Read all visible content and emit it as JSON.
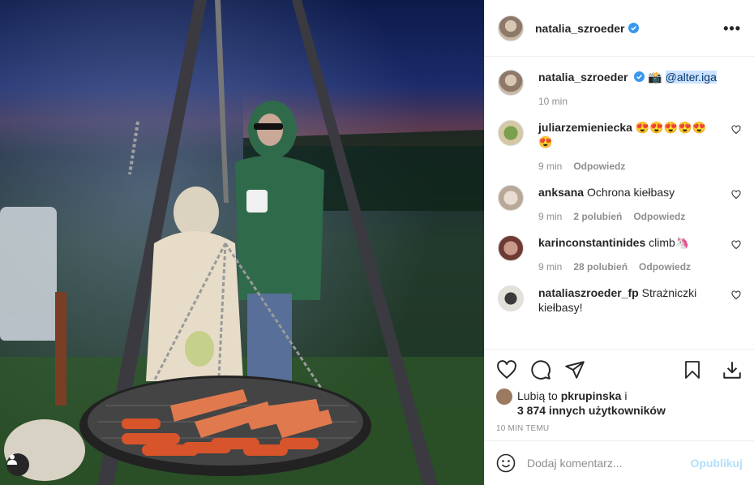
{
  "post": {
    "author": "natalia_szroeder",
    "verified": true,
    "more_label": "•••"
  },
  "caption": {
    "author": "natalia_szroeder",
    "emoji": "📸",
    "mention": "@alter.iga",
    "time": "10 min"
  },
  "comments": [
    {
      "user": "juliarzemieniecka",
      "text": "😍😍😍😍😍😍",
      "time": "9 min",
      "likes": "",
      "reply": "Odpowiedz"
    },
    {
      "user": "anksana",
      "text": "Ochrona kiełbasy",
      "time": "9 min",
      "likes": "2 polubień",
      "reply": "Odpowiedz"
    },
    {
      "user": "karinconstantinides",
      "text": "climb🦄",
      "time": "9 min",
      "likes": "28 polubień",
      "reply": "Odpowiedz"
    },
    {
      "user": "nataliaszroeder_fp",
      "text": "Strażniczki kiełbasy!",
      "time": "",
      "likes": "",
      "reply": ""
    }
  ],
  "likes": {
    "prefix": "Lubią to",
    "user": "pkrupinska",
    "suffix": "i",
    "others": "3 874 innych użytkowników"
  },
  "timestamp": "10 MIN TEMU",
  "add_comment": {
    "placeholder": "Dodaj komentarz...",
    "post_label": "Opublikuj"
  },
  "icons": [
    "heart-icon",
    "comment-icon",
    "share-icon",
    "bookmark-icon",
    "download-icon",
    "emoji-icon",
    "user-tag-icon",
    "verified-icon"
  ],
  "colors": {
    "verified": "#3897f0",
    "muted": "#8e8e8e",
    "post_disabled": "#b2dffc",
    "mention_bg": "#cce2ff"
  }
}
